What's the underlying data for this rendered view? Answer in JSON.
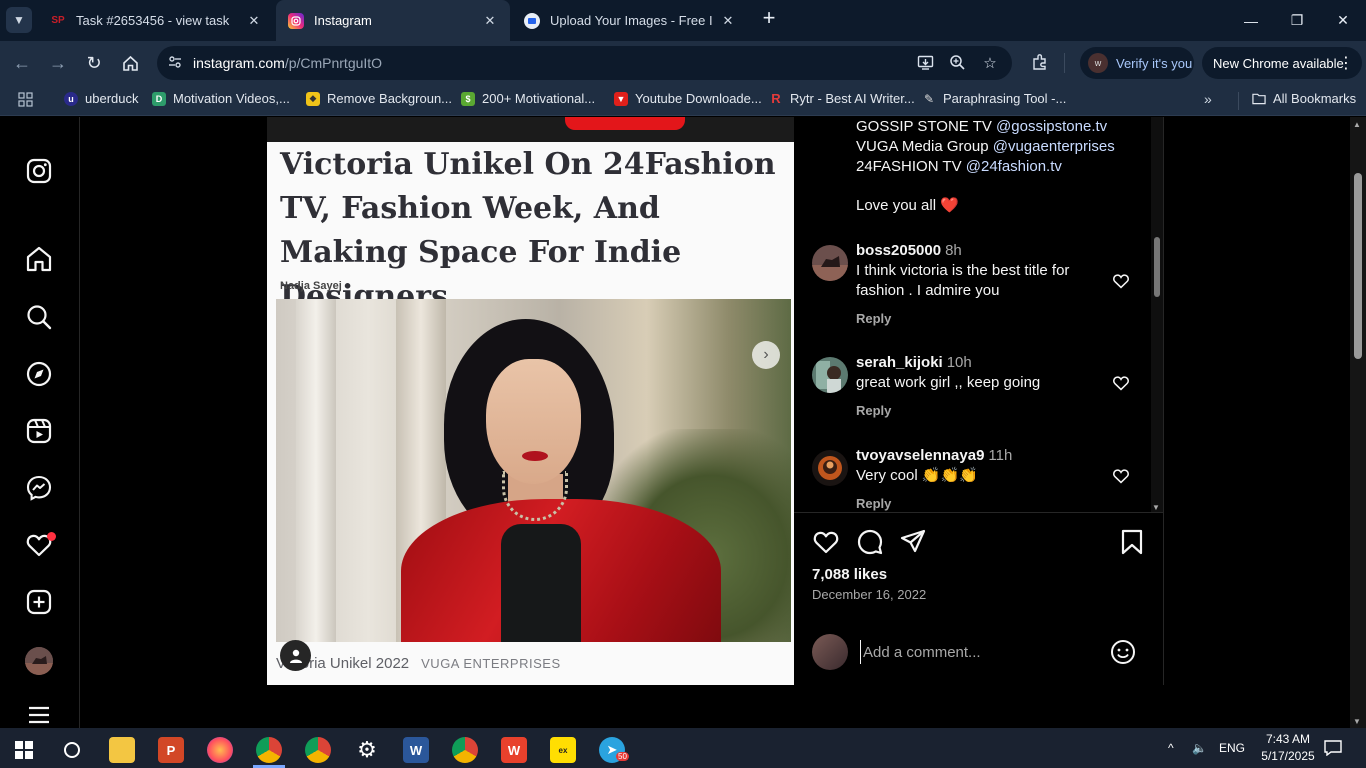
{
  "browser": {
    "tabs": [
      {
        "label": "Task #2653456 - view task",
        "favicon": "SP",
        "favicon_color": "#c81e28",
        "active": false
      },
      {
        "label": "Instagram",
        "favicon": "ig",
        "favicon_color": "#d62976",
        "active": true
      },
      {
        "label": "Upload Your Images - Free Ima",
        "favicon": "img",
        "favicon_color": "#3b82f6",
        "active": false
      }
    ],
    "new_tab_label": "+",
    "url_host": "instagram.com",
    "url_path": "/p/CmPnrtguItO",
    "verify_label": "Verify it's you",
    "update_label": "New Chrome available",
    "bookmarks": [
      {
        "label": "uberduck",
        "color": "#2a2a8a",
        "icon": "u"
      },
      {
        "label": "Motivation Videos,...",
        "color": "#2e9c6b",
        "icon": "D"
      },
      {
        "label": "Remove Backgroun...",
        "color": "#f0c419",
        "icon": "◆"
      },
      {
        "label": "200+ Motivational...",
        "color": "#5aa832",
        "icon": "$"
      },
      {
        "label": "Youtube Downloade...",
        "color": "#e0201b",
        "icon": "▼"
      },
      {
        "label": "Rytr - Best AI Writer...",
        "color": "#e33b3b",
        "icon": "R"
      },
      {
        "label": "Paraphrasing Tool -...",
        "color": "#444444",
        "icon": "✎"
      }
    ],
    "all_bookmarks_label": "All Bookmarks"
  },
  "post": {
    "headline": "Victoria Unikel On 24Fashion TV, Fashion Week, And Making Space For Indie Designers",
    "author": "Nadja Sayej",
    "image_caption_main": "Victoria Unikel 2022",
    "image_caption_credit": "VUGA ENTERPRISES",
    "caption_lines": [
      {
        "text": "GOSSIP STONE TV ",
        "mention": "@gossipstone.tv"
      },
      {
        "text": "VUGA Media Group ",
        "mention": "@vugaenterprises"
      },
      {
        "text": "24FASHION TV ",
        "mention": "@24fashion.tv"
      }
    ],
    "love_text": "Love you all ",
    "love_emoji": "❤️",
    "comments": [
      {
        "user": "boss205000",
        "time": "8h",
        "text": "I think victoria is the best title for fashion . I admire you",
        "reply": "Reply"
      },
      {
        "user": "serah_kijoki",
        "time": "10h",
        "text": "great work girl ,, keep going",
        "reply": "Reply"
      },
      {
        "user": "tvoyavselennaya9",
        "time": "11h",
        "text": "Very cool 👏👏👏",
        "reply": "Reply"
      }
    ],
    "likes": "7,088 likes",
    "date": "December 16, 2022",
    "comment_placeholder": "Add a comment..."
  },
  "taskbar": {
    "language": "ENG",
    "time": "7:43 AM",
    "date": "5/17/2025",
    "telegram_badge": "50"
  },
  "colors": {
    "ig_background": "#000000",
    "chrome_frame": "#0d1a2b",
    "chrome_toolbar": "#1f2e42",
    "notification_red": "#ff3040",
    "mention_blue": "#c9dbff"
  }
}
